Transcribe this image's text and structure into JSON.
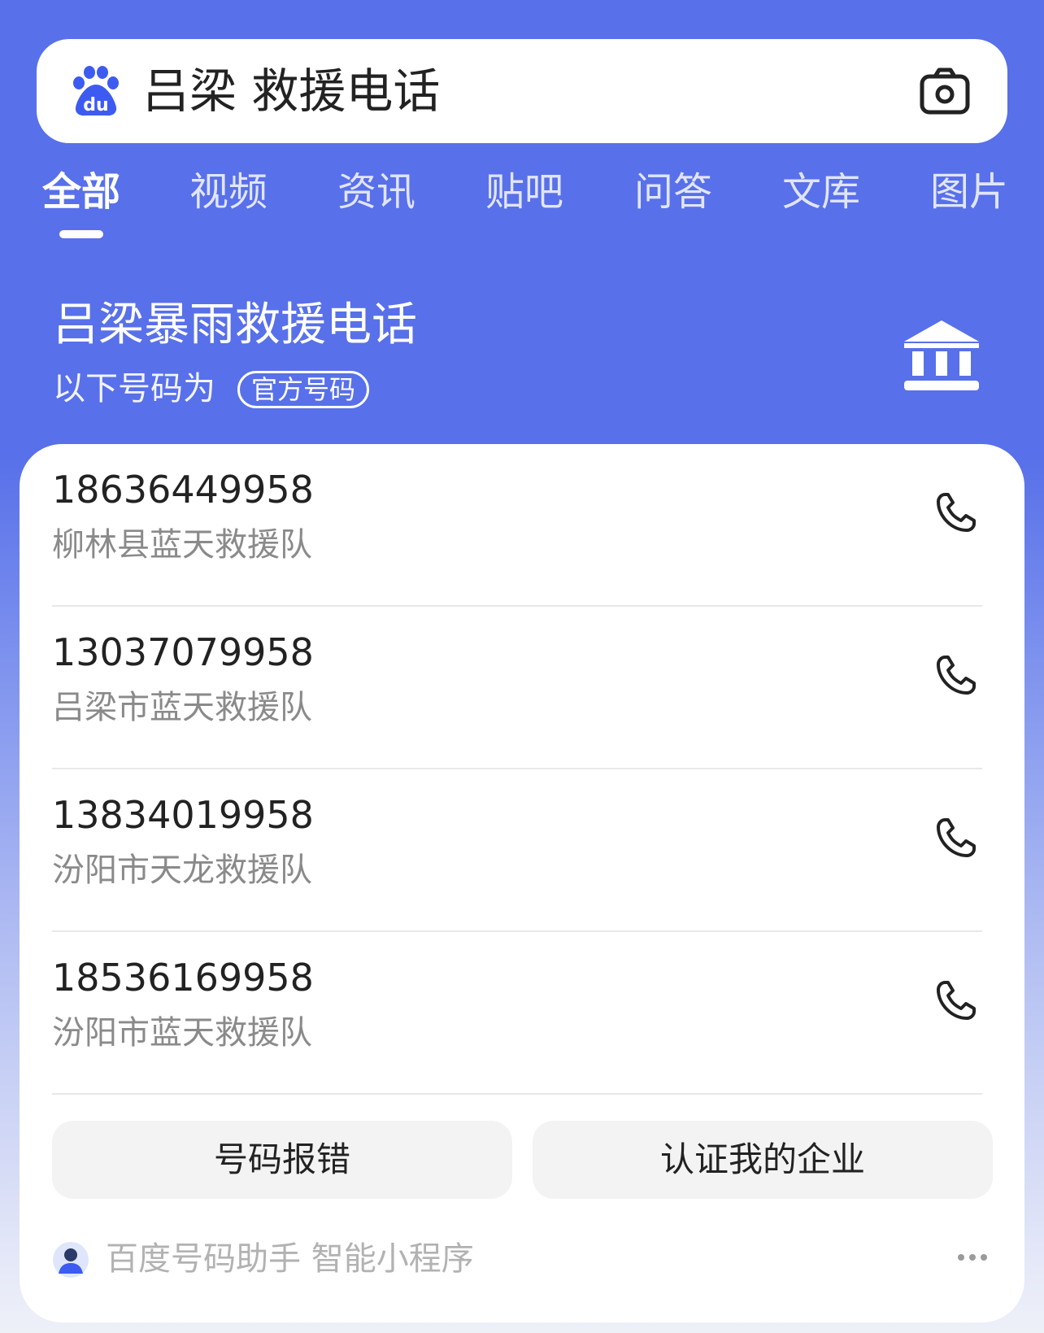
{
  "search": {
    "query": "吕梁 救援电话"
  },
  "tabs": [
    {
      "label": "全部",
      "active": true
    },
    {
      "label": "视频"
    },
    {
      "label": "资讯"
    },
    {
      "label": "贴吧"
    },
    {
      "label": "问答"
    },
    {
      "label": "文库"
    },
    {
      "label": "图片"
    }
  ],
  "result": {
    "title": "吕梁暴雨救援电话",
    "subtitle": "以下号码为",
    "badge": "官方号码",
    "icon": "government-building-icon"
  },
  "contacts": [
    {
      "number": "18636449958",
      "name": "柳林县蓝天救援队"
    },
    {
      "number": "13037079958",
      "name": "吕梁市蓝天救援队"
    },
    {
      "number": "13834019958",
      "name": "汾阳市天龙救援队"
    },
    {
      "number": "18536169958",
      "name": "汾阳市蓝天救援队"
    }
  ],
  "actions": {
    "report_error": "号码报错",
    "verify_company": "认证我的企业"
  },
  "footer": {
    "text": "百度号码助手 智能小程序"
  },
  "colors": {
    "brand_blue": "#5870e9",
    "baidu_logo": "#3d5bf0"
  }
}
